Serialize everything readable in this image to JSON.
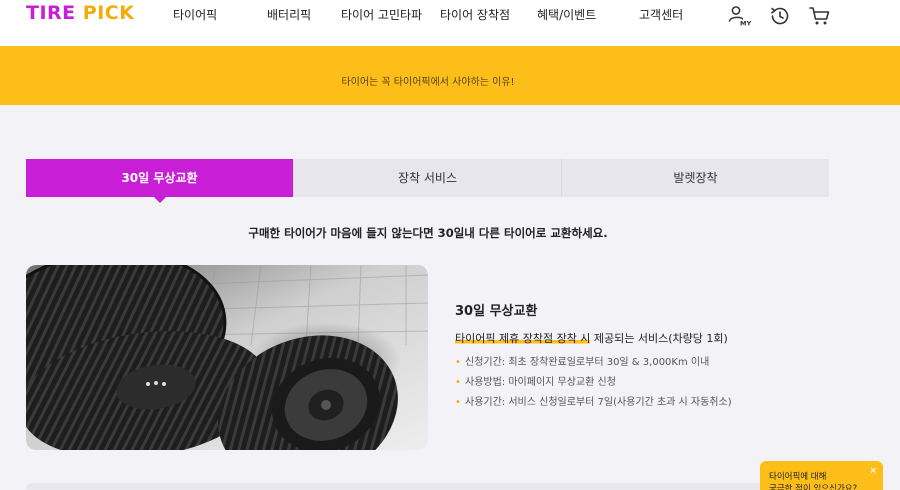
{
  "header": {
    "logo": {
      "part1": "TIRE",
      "part2": "PICK"
    },
    "nav": [
      "타이어픽",
      "배터리픽",
      "타이어 고민타파",
      "타이어 장착점",
      "혜택/이벤트",
      "고객센터"
    ],
    "icons": {
      "my": {
        "name": "user-my-icon",
        "label": "MY"
      },
      "recent": {
        "name": "history-clock-icon"
      },
      "cart": {
        "name": "cart-icon"
      }
    }
  },
  "banner": {
    "text": "타이어는 꼭 타이어픽에서 사야하는 이유!"
  },
  "tabs": [
    {
      "label": "30일 무상교환",
      "active": true
    },
    {
      "label": "장착 서비스",
      "active": false
    },
    {
      "label": "발렛장착",
      "active": false
    }
  ],
  "tagline": "구매한 타이어가 마음에 들지 않는다면 30일내 다른 타이어로 교환하세요.",
  "detail": {
    "title": "30일 무상교환",
    "subtitle_highlight": "타이어픽 제휴 장착점 장착 시",
    "subtitle_rest": " 제공되는 서비스(차량당 1회)",
    "bullets": [
      "신청기간: 최초 장착완료일로부터 30일 & 3,000Km 이내",
      "사용방법: 마이페이지 무상교환 신청",
      "사용기간: 서비스 신청일로부터 7일(사용기간 초과 시 자동취소)"
    ]
  },
  "chat": {
    "line1": "타이어픽에 대해",
    "line2": "궁금한 점이 있으신가요?",
    "close": "×"
  },
  "colors": {
    "brand_purple": "#c81fd6",
    "brand_yellow": "#fdbe1a"
  }
}
